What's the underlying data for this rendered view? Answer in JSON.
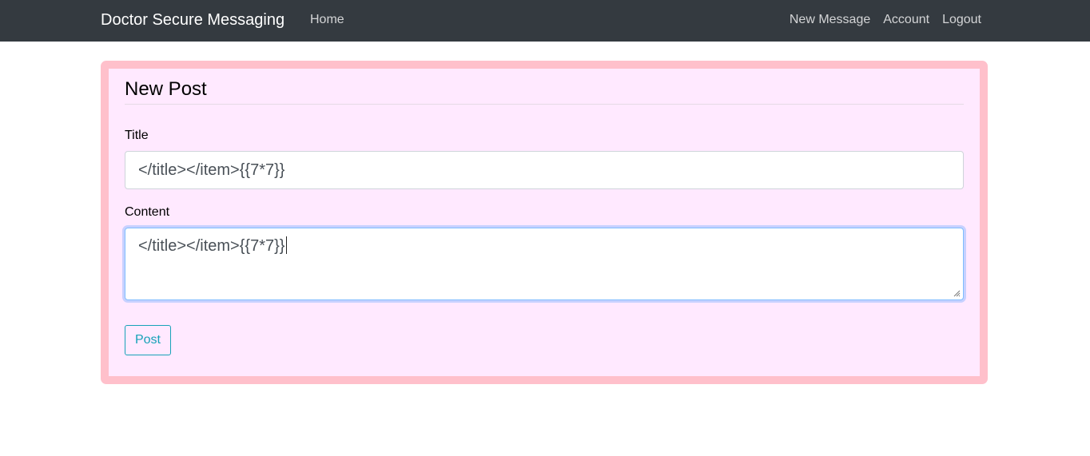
{
  "navbar": {
    "brand": "Doctor Secure Messaging",
    "links": {
      "home": "Home",
      "new_message": "New Message",
      "account": "Account",
      "logout": "Logout"
    }
  },
  "form": {
    "heading": "New Post",
    "title_label": "Title",
    "title_value": "</title></item>{{7*7}}",
    "content_label": "Content",
    "content_value": "</title></item>{{7*7}}",
    "submit_label": "Post"
  },
  "colors": {
    "navbar_bg": "#343a40",
    "card_bg": "#ffe9ff",
    "card_border": "#ffc0cb",
    "button_accent": "#17a2b8",
    "focus_border": "#80bdff"
  }
}
